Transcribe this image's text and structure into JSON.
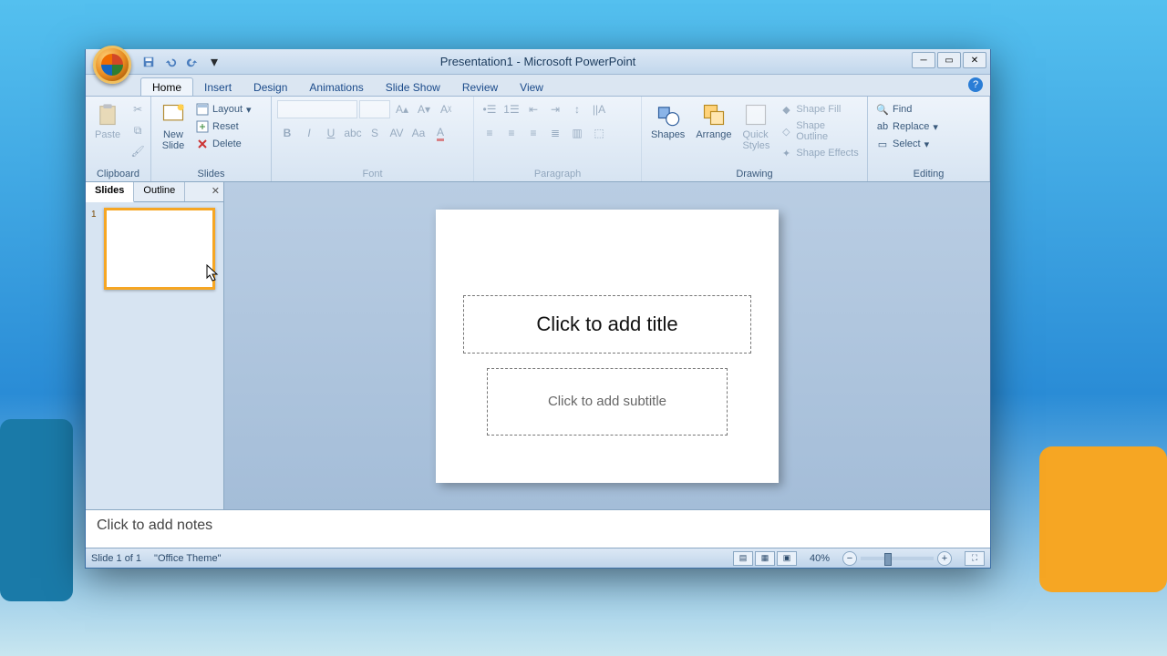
{
  "window_title": "Presentation1 - Microsoft PowerPoint",
  "tabs": [
    "Home",
    "Insert",
    "Design",
    "Animations",
    "Slide Show",
    "Review",
    "View"
  ],
  "active_tab": "Home",
  "ribbon": {
    "clipboard": {
      "label": "Clipboard",
      "paste": "Paste"
    },
    "slides": {
      "label": "Slides",
      "new_slide": "New\nSlide",
      "layout": "Layout",
      "reset": "Reset",
      "delete": "Delete"
    },
    "font": {
      "label": "Font"
    },
    "paragraph": {
      "label": "Paragraph"
    },
    "drawing": {
      "label": "Drawing",
      "shapes": "Shapes",
      "arrange": "Arrange",
      "quick": "Quick\nStyles",
      "fill": "Shape Fill",
      "outline": "Shape Outline",
      "effects": "Shape Effects"
    },
    "editing": {
      "label": "Editing",
      "find": "Find",
      "replace": "Replace",
      "select": "Select"
    }
  },
  "pane": {
    "slides_tab": "Slides",
    "outline_tab": "Outline",
    "slide_number": "1"
  },
  "slide": {
    "title_placeholder": "Click to add title",
    "subtitle_placeholder": "Click to add subtitle"
  },
  "notes_placeholder": "Click to add notes",
  "status": {
    "slide_info": "Slide 1 of 1",
    "theme": "\"Office Theme\"",
    "zoom": "40%"
  }
}
